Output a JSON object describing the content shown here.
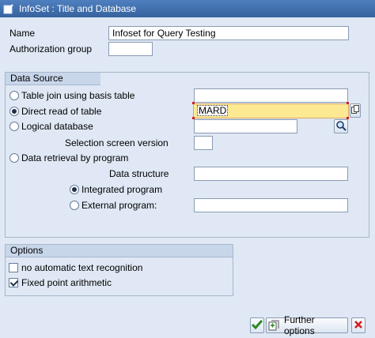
{
  "window": {
    "title": "InfoSet  : Title and Database"
  },
  "header": {
    "name_label": "Name",
    "name_value": "Infoset for Query Testing",
    "auth_label": "Authorization group",
    "auth_value": ""
  },
  "data_source": {
    "title": "Data Source",
    "table_join_label": "Table join using basis table",
    "table_join_value": "",
    "direct_read_label": "Direct read of table",
    "direct_read_value": "MARD",
    "logical_db_label": "Logical database",
    "logical_db_value": "",
    "selection_screen_label": "Selection screen version",
    "selection_screen_value": "",
    "data_retrieval_label": "Data retrieval by program",
    "data_structure_label": "Data structure",
    "data_structure_value": "",
    "integrated_label": "Integrated program",
    "external_label": "External program:",
    "external_value": ""
  },
  "options": {
    "title": "Options",
    "no_auto_text_label": "no automatic text recognition",
    "no_auto_text_checked": false,
    "fixed_point_label": "Fixed point arithmetic",
    "fixed_point_checked": true
  },
  "footer": {
    "further_options_label": "Further options"
  },
  "colors": {
    "titlebar": "#36639e",
    "background": "#dfe8f4",
    "active_field": "#fde992"
  }
}
